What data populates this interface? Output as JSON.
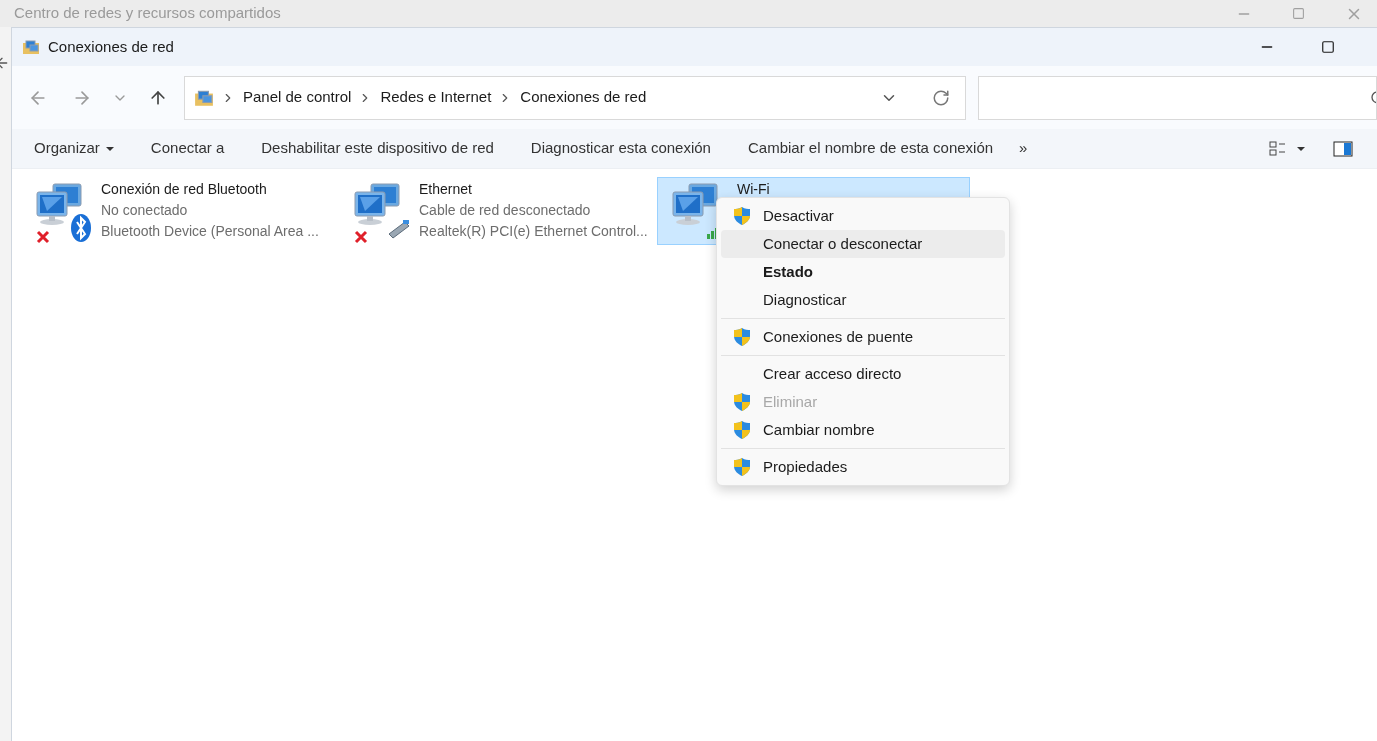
{
  "background_window": {
    "title": "Centro de redes y recursos compartidos"
  },
  "window": {
    "title": "Conexiones de red"
  },
  "address_bar": {
    "breadcrumbs": [
      "Panel de control",
      "Redes e Internet",
      "Conexiones de red"
    ]
  },
  "toolbar": {
    "items": [
      {
        "label": "Organizar",
        "dropdown": true
      },
      {
        "label": "Conectar a",
        "dropdown": false
      },
      {
        "label": "Deshabilitar este dispositivo de red",
        "dropdown": false
      },
      {
        "label": "Diagnosticar esta conexión",
        "dropdown": false
      },
      {
        "label": "Cambiar el nombre de esta conexión",
        "dropdown": false
      }
    ],
    "overflow": "»"
  },
  "connections": [
    {
      "kind": "bluetooth",
      "name": "Conexión de red Bluetooth",
      "status": "No conectado",
      "device": "Bluetooth Device (Personal Area ...",
      "connected": false,
      "selected": false
    },
    {
      "kind": "ethernet",
      "name": "Ethernet",
      "status": "Cable de red desconectado",
      "device": "Realtek(R) PCI(e) Ethernet Control...",
      "connected": false,
      "selected": false
    },
    {
      "kind": "wifi",
      "name": "Wi-Fi",
      "connected": true,
      "selected": true
    }
  ],
  "context_menu": {
    "groups": [
      [
        {
          "label": "Desactivar",
          "shield": true,
          "default": false,
          "disabled": false,
          "hovered": false
        },
        {
          "label": "Conectar o desconectar",
          "shield": false,
          "default": false,
          "disabled": false,
          "hovered": true
        },
        {
          "label": "Estado",
          "shield": false,
          "default": true,
          "disabled": false,
          "hovered": false
        },
        {
          "label": "Diagnosticar",
          "shield": false,
          "default": false,
          "disabled": false,
          "hovered": false
        }
      ],
      [
        {
          "label": "Conexiones de puente",
          "shield": true,
          "default": false,
          "disabled": false,
          "hovered": false
        }
      ],
      [
        {
          "label": "Crear acceso directo",
          "shield": false,
          "default": false,
          "disabled": false,
          "hovered": false
        },
        {
          "label": "Eliminar",
          "shield": true,
          "default": false,
          "disabled": true,
          "hovered": false
        },
        {
          "label": "Cambiar nombre",
          "shield": true,
          "default": false,
          "disabled": false,
          "hovered": false
        }
      ],
      [
        {
          "label": "Propiedades",
          "shield": true,
          "default": false,
          "disabled": false,
          "hovered": false
        }
      ]
    ]
  }
}
